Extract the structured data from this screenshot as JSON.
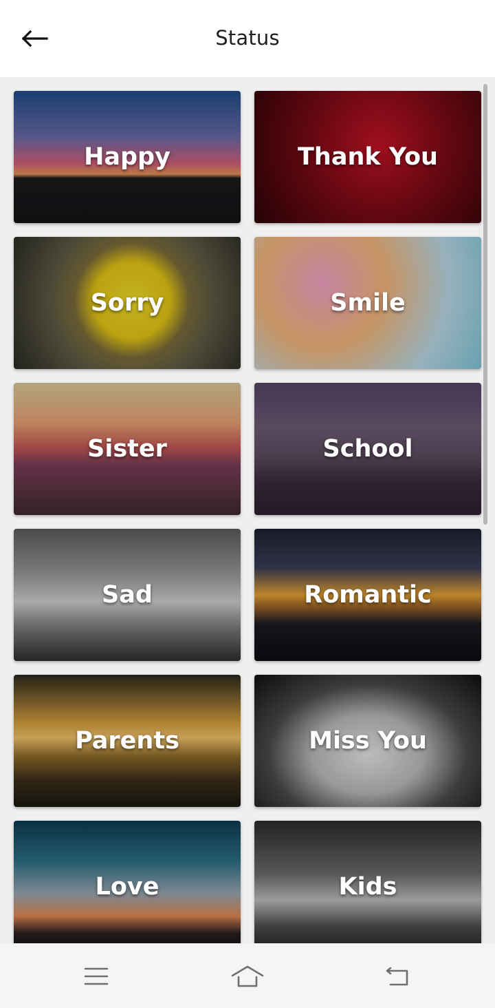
{
  "header": {
    "title": "Status",
    "back_icon": "arrow-left-icon"
  },
  "categories": [
    {
      "label": "Happy"
    },
    {
      "label": "Thank You"
    },
    {
      "label": "Sorry"
    },
    {
      "label": "Smile"
    },
    {
      "label": "Sister"
    },
    {
      "label": "School"
    },
    {
      "label": "Sad"
    },
    {
      "label": "Romantic"
    },
    {
      "label": "Parents"
    },
    {
      "label": "Miss You"
    },
    {
      "label": "Love"
    },
    {
      "label": "Kids"
    }
  ],
  "system_nav": {
    "menu_icon": "menu-icon",
    "home_icon": "home-icon",
    "back_icon": "back-icon"
  },
  "colors": {
    "appbar_bg": "#ffffff",
    "content_bg": "#efefef",
    "label_text": "#ffffff"
  }
}
